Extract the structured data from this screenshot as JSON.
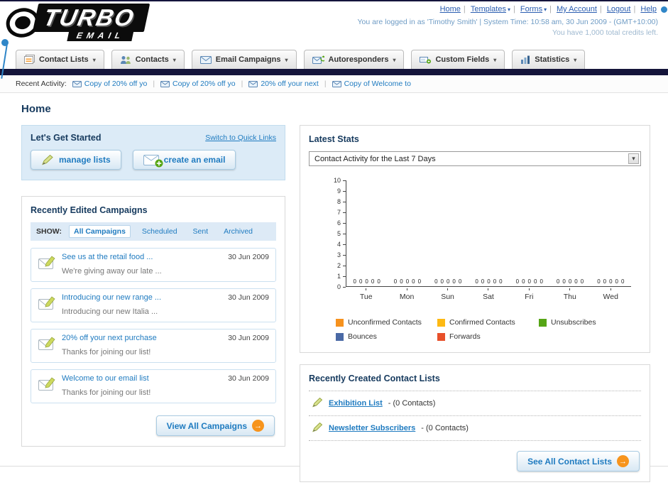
{
  "header": {
    "logo": {
      "title": "TURBO",
      "subtitle": "EMAIL"
    },
    "nav_links": [
      "Home",
      "Templates",
      "Forms",
      "My Account",
      "Logout",
      "Help"
    ],
    "login_info": "You are logged in as 'Timothy Smith' | System Time: 10:58 am, 30 Jun 2009 - (GMT+10:00)",
    "credits_info": "You have 1,000 total credits left."
  },
  "nav_tabs": [
    {
      "label": "Contact Lists"
    },
    {
      "label": "Contacts"
    },
    {
      "label": "Email Campaigns"
    },
    {
      "label": "Autoresponders"
    },
    {
      "label": "Custom Fields"
    },
    {
      "label": "Statistics"
    }
  ],
  "recent_activity": {
    "label": "Recent Activity:",
    "items": [
      "Copy of 20% off yo",
      "Copy of 20% off yo",
      "20% off your next",
      "Copy of Welcome to"
    ]
  },
  "page_title": "Home",
  "get_started": {
    "title": "Let's Get Started",
    "switch_link": "Switch to Quick Links",
    "manage_lists_label": "manage lists",
    "create_email_label": "create an email"
  },
  "campaigns": {
    "title": "Recently Edited Campaigns",
    "show_label": "SHOW:",
    "filters": [
      "All Campaigns",
      "Scheduled",
      "Sent",
      "Archived"
    ],
    "selected_filter": "All Campaigns",
    "items": [
      {
        "title": "See us at the retail food ...",
        "subtitle": "We're giving away our late ...",
        "date": "30 Jun 2009"
      },
      {
        "title": "Introducing our new range ...",
        "subtitle": "Introducing our new Italia ...",
        "date": "30 Jun 2009"
      },
      {
        "title": "20% off your next purchase",
        "subtitle": "Thanks for joining our list!",
        "date": "30 Jun 2009"
      },
      {
        "title": "Welcome to our email list",
        "subtitle": "Thanks for joining our list!",
        "date": "30 Jun 2009"
      }
    ],
    "view_all_label": "View All Campaigns"
  },
  "stats": {
    "title": "Latest Stats",
    "activity_filter": "Contact Activity for the Last 7 Days",
    "chart_data": {
      "type": "bar",
      "title": "Contact Activity for the Last 7 Days",
      "categories": [
        "Tue",
        "Mon",
        "Sun",
        "Sat",
        "Fri",
        "Thu",
        "Wed"
      ],
      "series": [
        {
          "name": "Unconfirmed Contacts",
          "color": "#f6921e",
          "values": [
            0,
            0,
            0,
            0,
            0,
            0,
            0
          ]
        },
        {
          "name": "Confirmed Contacts",
          "color": "#fdb913",
          "values": [
            0,
            0,
            0,
            0,
            0,
            0,
            0
          ]
        },
        {
          "name": "Unsubscribes",
          "color": "#56a516",
          "values": [
            0,
            0,
            0,
            0,
            0,
            0,
            0
          ]
        },
        {
          "name": "Bounces",
          "color": "#4a69a5",
          "values": [
            0,
            0,
            0,
            0,
            0,
            0,
            0
          ]
        },
        {
          "name": "Forwards",
          "color": "#e8502a",
          "values": [
            0,
            0,
            0,
            0,
            0,
            0,
            0
          ]
        }
      ],
      "xlabel": "",
      "ylabel": "",
      "ylim": [
        0,
        10
      ],
      "grid": false,
      "legend_position": "bottom",
      "bar_value_labels_shown": true
    }
  },
  "contact_lists": {
    "title": "Recently Created Contact Lists",
    "items": [
      {
        "name": "Exhibition List",
        "detail": "- (0 Contacts)"
      },
      {
        "name": "Newsletter Subscribers",
        "detail": "- (0 Contacts)"
      }
    ],
    "see_all_label": "See All Contact Lists"
  },
  "colors": {
    "accent_orange": "#f7941d",
    "link_blue": "#1f7bc0",
    "dark_navy": "#14143a",
    "panel_blue": "#dcebf7"
  }
}
